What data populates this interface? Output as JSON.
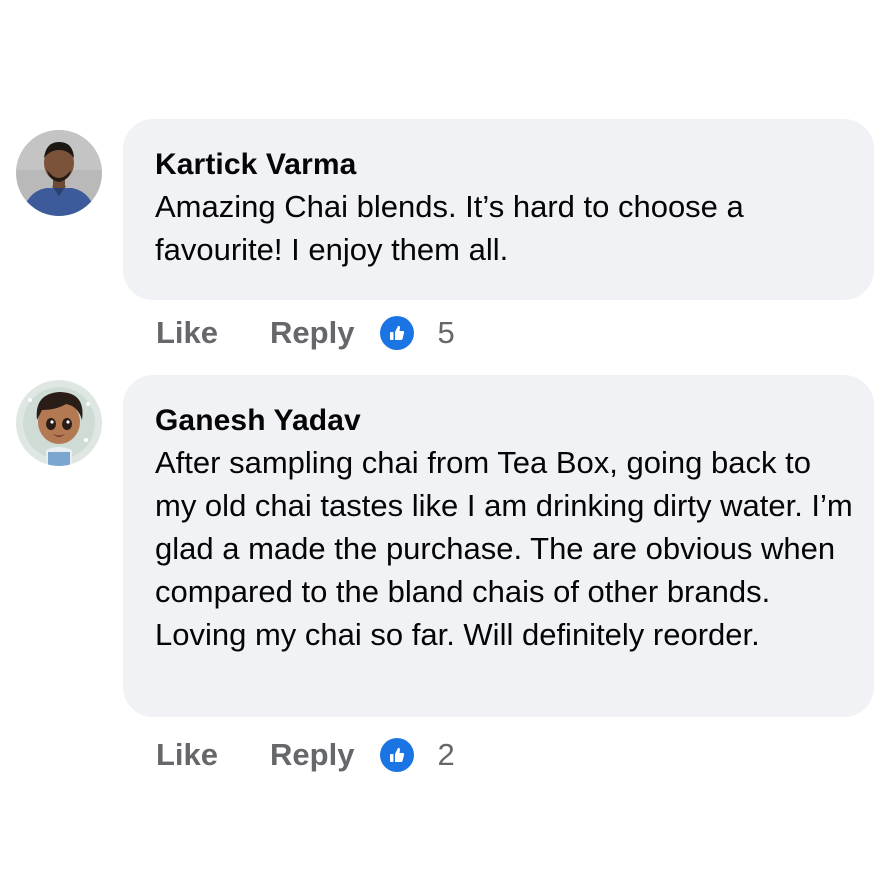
{
  "comments": [
    {
      "author": "Kartick Varma",
      "text": "Amazing Chai blends. It’s hard to choose a favourite! I enjoy them all.",
      "like_label": "Like",
      "reply_label": "Reply",
      "reaction_icon": "thumbs-up-icon",
      "reaction_count": "5"
    },
    {
      "author": "Ganesh Yadav",
      "text": "After sampling chai from Tea Box, going back to my old chai tastes like I am drinking dirty water. I’m glad a made the purchase. The are obvious when compared to the bland chais of other brands. Loving my chai so far. Will definitely reorder.",
      "like_label": "Like",
      "reply_label": "Reply",
      "reaction_icon": "thumbs-up-icon",
      "reaction_count": "2"
    }
  ],
  "colors": {
    "bubble_background": "#f0f2f5",
    "action_text": "#65676b",
    "like_badge": "#1b74e4"
  }
}
